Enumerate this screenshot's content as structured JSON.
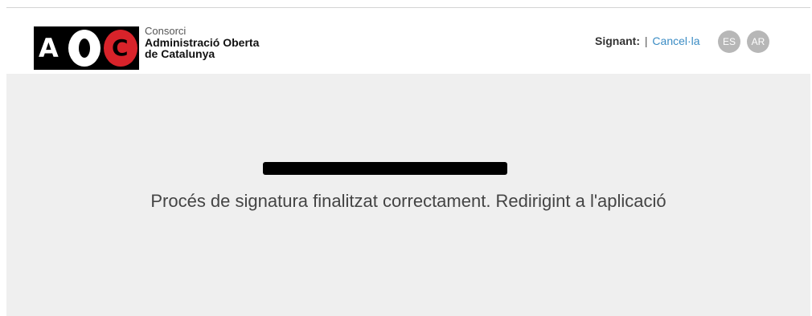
{
  "header": {
    "logo": {
      "letters": [
        "A",
        "C"
      ],
      "colors": {
        "background": "#000000",
        "accent": "#d8232a"
      }
    },
    "org_name": {
      "line1": "Consorci",
      "line2": "Administració Oberta",
      "line3": "de Catalunya"
    },
    "signant_label": "Signant:",
    "separator": "|",
    "cancel_link": "Cancel·la",
    "languages": [
      "ES",
      "AR"
    ]
  },
  "main": {
    "message": "Procés de signatura finalitzat correctament. Redirigint a l'aplicació"
  },
  "colors": {
    "link": "#3b8cc4",
    "content_background": "#efefef",
    "language_badge": "#b7b7b7"
  }
}
